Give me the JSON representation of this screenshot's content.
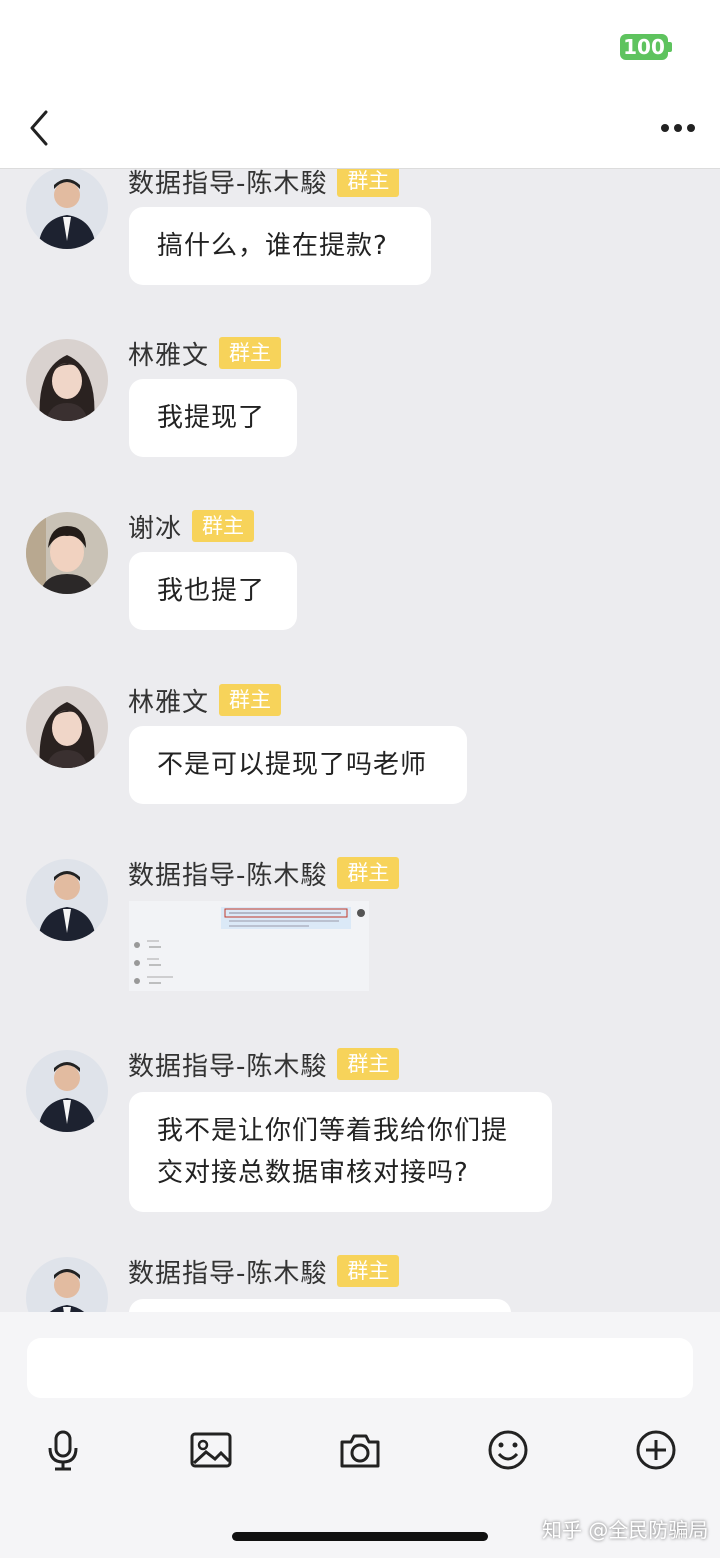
{
  "status_bar": {
    "battery": "100"
  },
  "nav": {
    "back_icon": "chevron-left-icon",
    "more_icon": "more-horizontal-icon"
  },
  "messages": [
    {
      "sender": "数据指导-陈木駿",
      "badge": "群主",
      "text": "搞什么，谁在提款?"
    },
    {
      "sender": "林雅文",
      "badge": "群主",
      "text": "我提现了"
    },
    {
      "sender": "谢冰",
      "badge": "群主",
      "text": "我也提了"
    },
    {
      "sender": "林雅文",
      "badge": "群主",
      "text": "不是可以提现了吗老师"
    },
    {
      "sender": "数据指导-陈木駿",
      "badge": "群主",
      "image": "screenshot-thumbnail"
    },
    {
      "sender": "数据指导-陈木駿",
      "badge": "群主",
      "text": "我不是让你们等着我给你们提交对接总数据审核对接吗?"
    },
    {
      "sender": "数据指导-陈木駿",
      "badge": "群主",
      "text": ""
    }
  ],
  "input": {
    "placeholder": ""
  },
  "toolbar": {
    "icons": [
      "microphone-icon",
      "image-icon",
      "camera-icon",
      "emoji-icon",
      "plus-icon"
    ]
  },
  "watermark": "知乎 @全民防骗局"
}
